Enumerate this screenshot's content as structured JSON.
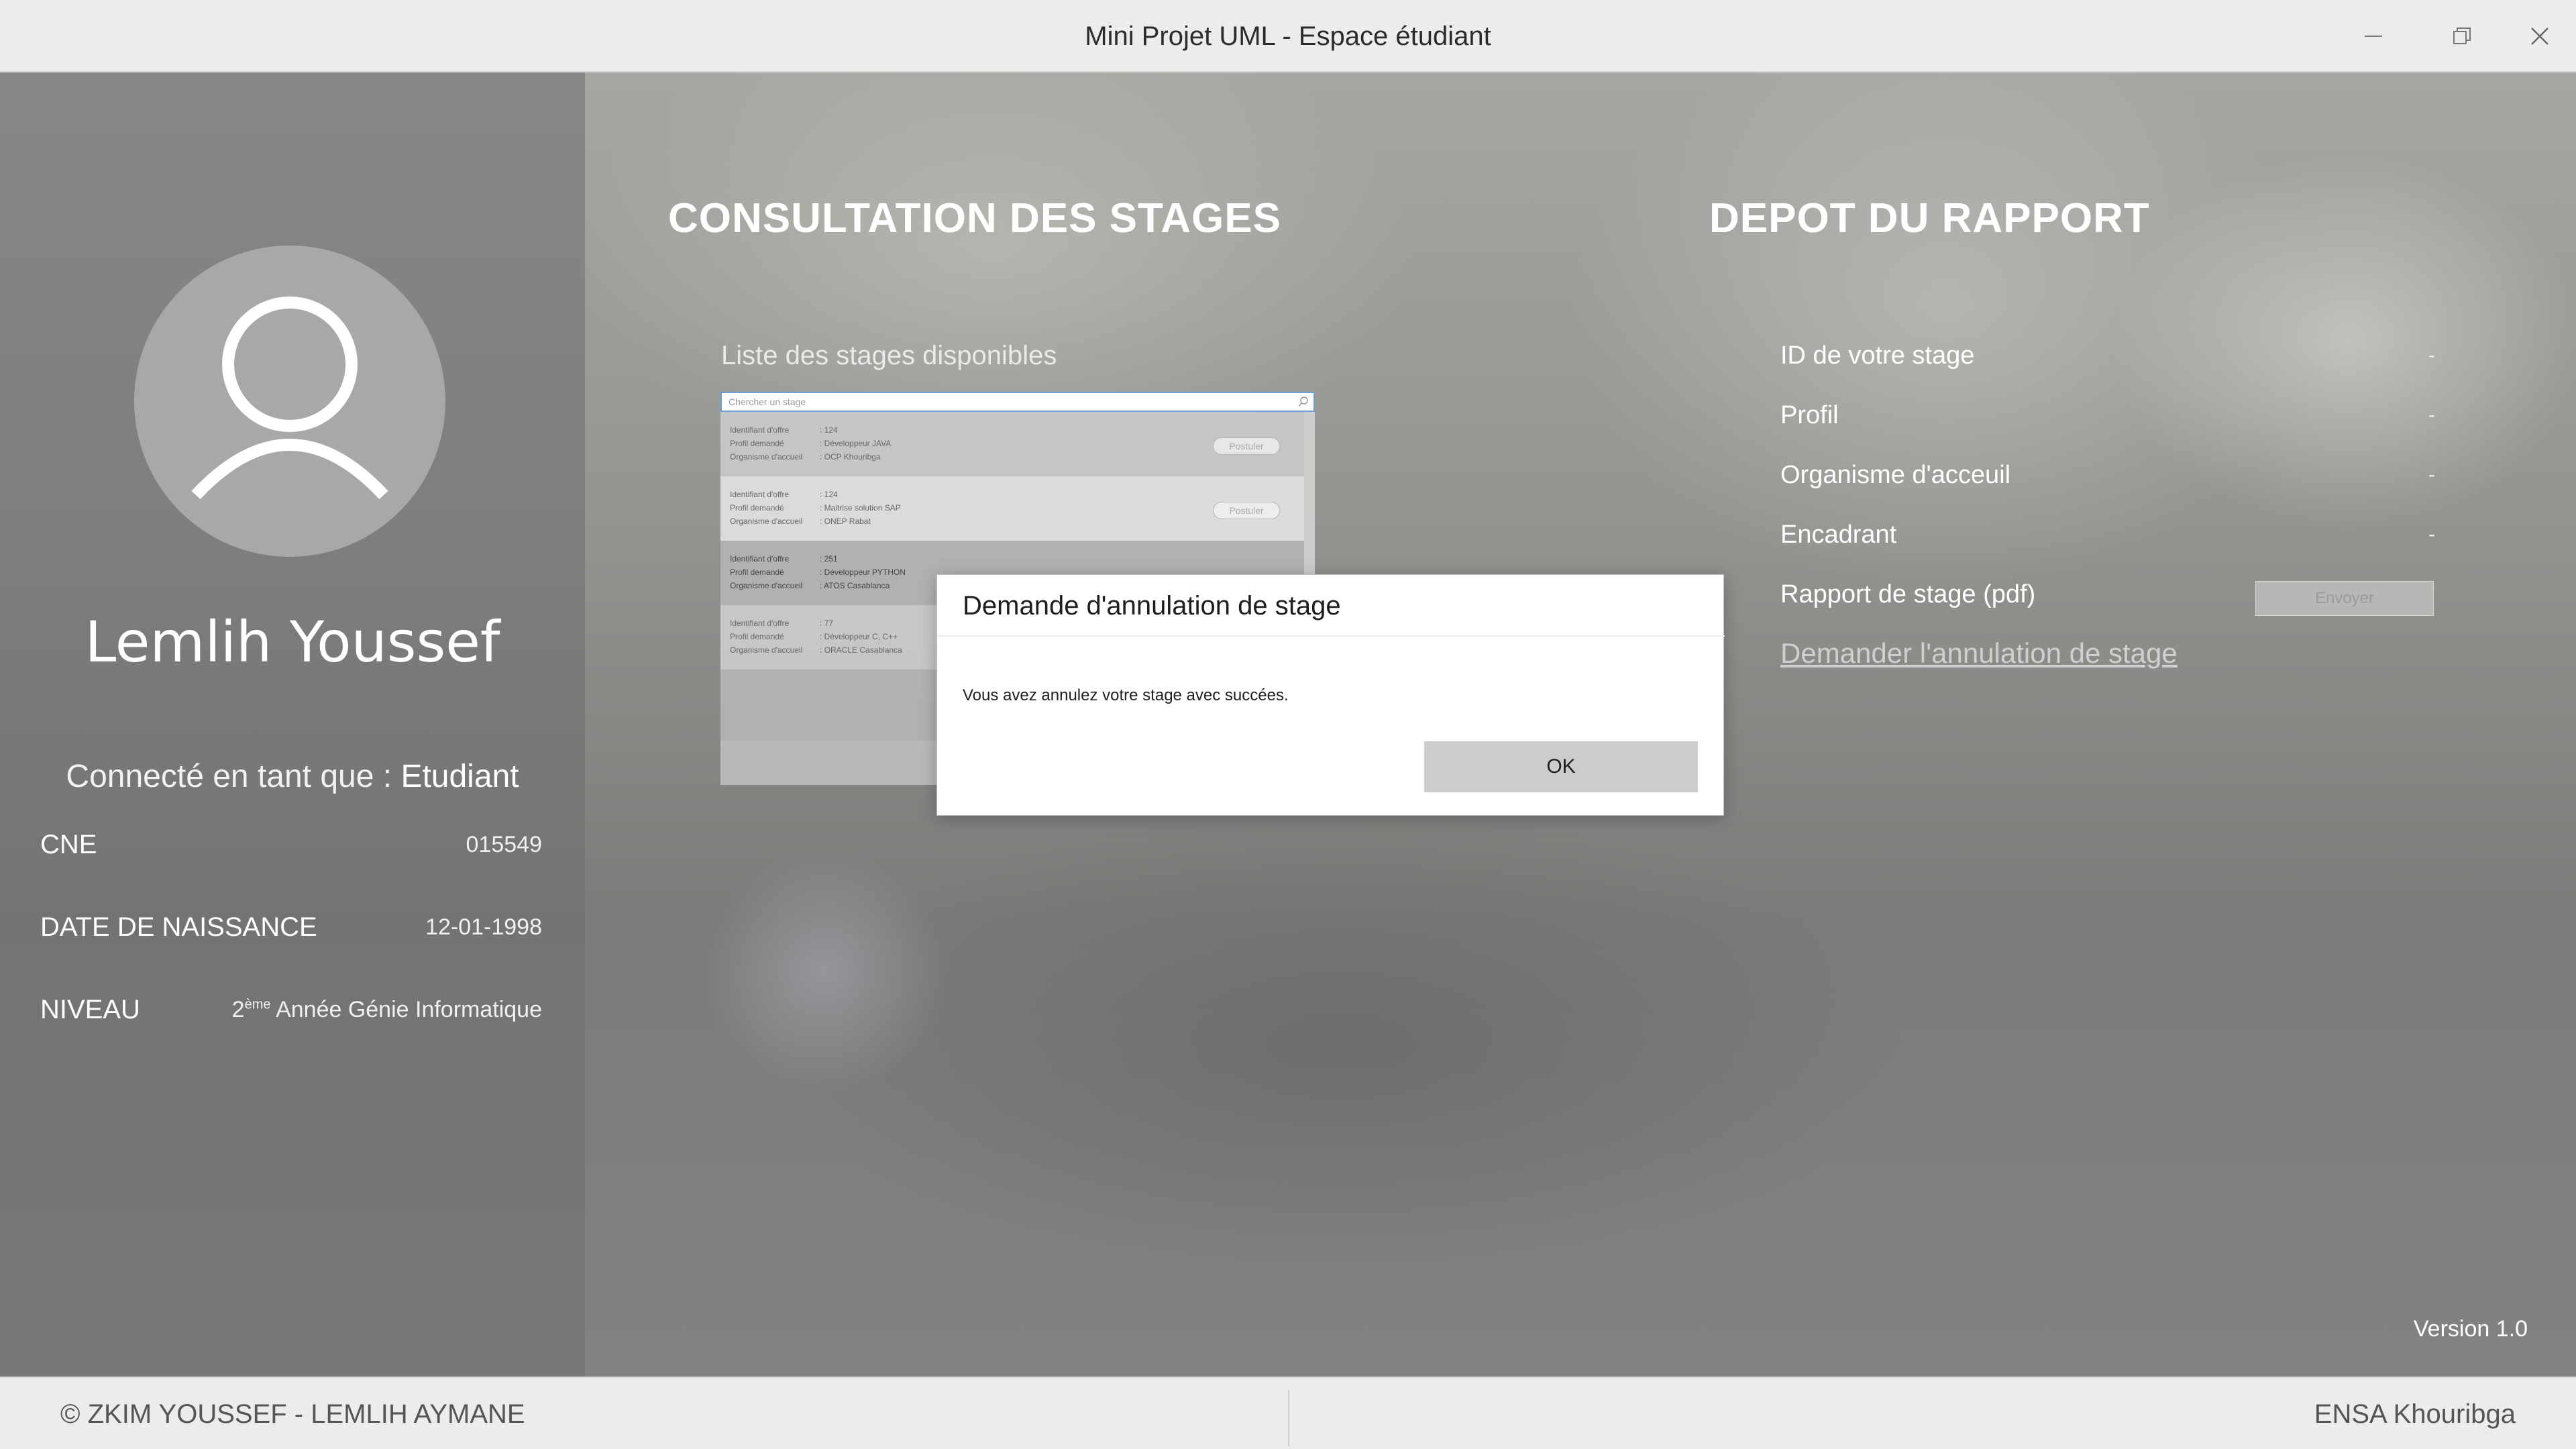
{
  "window": {
    "title": "Mini Projet UML - Espace étudiant"
  },
  "profile": {
    "name": "Lemlih Youssef",
    "role_prefix": "Connecté en tant que : ",
    "role": "Etudiant",
    "fields": [
      {
        "label": "CNE",
        "value": "015549"
      },
      {
        "label": "DATE DE NAISSANCE",
        "value": "12-01-1998"
      },
      {
        "label": "NIVEAU",
        "value_sup_base": "2",
        "value_sup": "ème",
        "value_rest": " Année Génie Informatique"
      }
    ]
  },
  "consultation": {
    "heading": "CONSULTATION DES STAGES",
    "list_caption": "Liste des stages disponibles",
    "search_placeholder": "Chercher un stage",
    "label_id": "Identifiant d'offre",
    "label_profil": "Profil demandé",
    "label_org": "Organisme d'accueil",
    "apply_label": "Postuler",
    "stages": [
      {
        "id": ": 124",
        "profil": ": Développeur JAVA",
        "org": ": OCP Khouribga"
      },
      {
        "id": ": 124",
        "profil": ": Maitrise solution SAP",
        "org": ": ONEP Rabat"
      },
      {
        "id": ": 251",
        "profil": ": Développeur PYTHON",
        "org": ": ATOS Casablanca"
      },
      {
        "id": ": 77",
        "profil": ": Développeur C, C++",
        "org": ": ORACLE Casablanca"
      }
    ]
  },
  "depot": {
    "heading": "DEPOT DU RAPPORT",
    "rows": [
      {
        "label": "ID de votre stage",
        "value": "-"
      },
      {
        "label": "Profil",
        "value": "-"
      },
      {
        "label": "Organisme d'acceuil",
        "value": "-"
      },
      {
        "label": "Encadrant",
        "value": "-"
      },
      {
        "label": "Rapport de stage (pdf)",
        "value": ""
      }
    ],
    "send_label": "Envoyer",
    "cancel_link": "Demander l'annulation de stage"
  },
  "version": "Version 1.0",
  "footer": {
    "left": "© ZKIM YOUSSEF - LEMLIH AYMANE",
    "right": "ENSA Khouribga"
  },
  "dialog": {
    "title": "Demande d'annulation de stage",
    "message": "Vous avez annulez votre stage avec succées.",
    "ok_label": "OK"
  },
  "icons": {
    "minimize": "minimize-icon",
    "maximize": "restore-icon",
    "close": "close-icon",
    "avatar": "user-icon",
    "search": "search-icon"
  }
}
